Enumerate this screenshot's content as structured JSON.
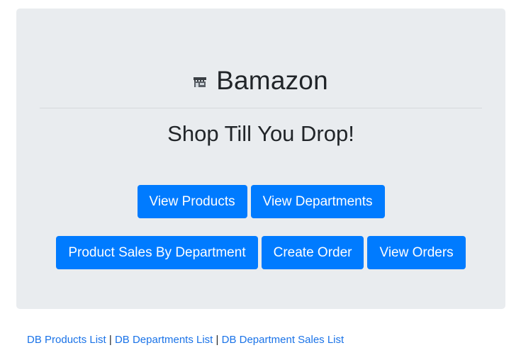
{
  "header": {
    "title": "Bamazon",
    "subtitle": "Shop Till You Drop!",
    "icon": "store-icon"
  },
  "buttons": {
    "view_products": "View Products",
    "view_departments": "View Departments",
    "product_sales_by_department": "Product Sales By Department",
    "create_order": "Create Order",
    "view_orders": "View Orders"
  },
  "footer": {
    "link1": "DB Products List",
    "link2": "DB Departments List",
    "link3": "DB Department Sales List",
    "separator": "|"
  },
  "colors": {
    "accent": "#007bff",
    "panel": "#e9ecef",
    "link": "#1a73e8"
  }
}
